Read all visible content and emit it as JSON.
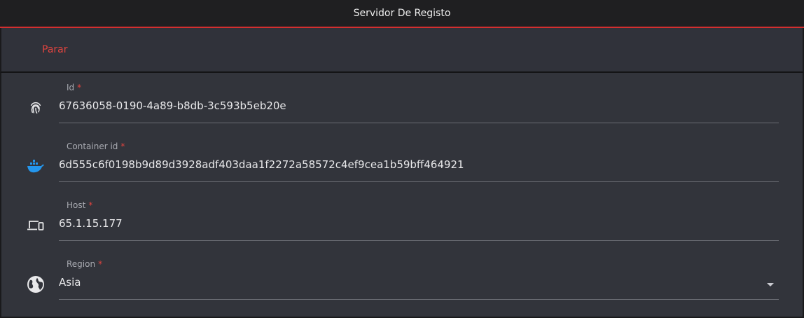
{
  "window": {
    "title": "Servidor De Registo"
  },
  "toolbar": {
    "stop_label": "Parar"
  },
  "colors": {
    "accent": "#d32f2f",
    "docker_blue": "#2496ed"
  },
  "fields": [
    {
      "label": "Id",
      "required": "*",
      "value": "67636058-0190-4a89-b8db-3c593b5eb20e",
      "icon": "fingerprint-icon"
    },
    {
      "label": "Container id",
      "required": "*",
      "value": "6d555c6f0198b9d89d3928adf403daa1f2272a58572c4ef9cea1b59bff464921",
      "icon": "docker-icon"
    },
    {
      "label": "Host",
      "required": "*",
      "value": "65.1.15.177",
      "icon": "devices-icon"
    },
    {
      "label": "Region",
      "required": "*",
      "value": "Asia",
      "icon": "globe-icon"
    }
  ]
}
